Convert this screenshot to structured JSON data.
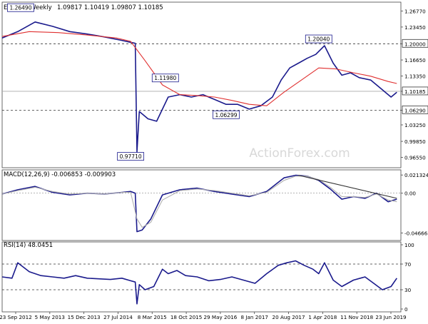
{
  "chart_data": [
    {
      "type": "line",
      "panel": "price",
      "title": "EURCHF Weekly",
      "ohlc_text": "1.09817 1.10419 1.09807 1.10185",
      "ylim": [
        0.95,
        1.28
      ],
      "yticks": [
        "1.26770",
        "1.23450",
        "1.20000",
        "1.16650",
        "1.13350",
        "1.10185",
        "1.06290",
        "1.03250",
        "0.99850",
        "0.96550"
      ],
      "ytick_values": [
        1.2677,
        1.2345,
        1.2,
        1.1665,
        1.1335,
        1.10185,
        1.0629,
        1.0325,
        0.9985,
        0.9655
      ],
      "current_price": 1.10185,
      "hlines": [
        1.2,
        1.10185,
        1.0629
      ],
      "dashed_lines": [
        1.2,
        1.0629
      ],
      "grid": false,
      "series": [
        {
          "name": "",
          "color": "#1a1a8c",
          "x": [
            2012.73,
            2013.0,
            2013.3,
            2013.6,
            2013.9,
            2014.2,
            2014.5,
            2014.8,
            2014.95,
            2015.03,
            2015.06,
            2015.1,
            2015.25,
            2015.4,
            2015.6,
            2015.8,
            2016.0,
            2016.2,
            2016.4,
            2016.6,
            2016.8,
            2017.0,
            2017.2,
            2017.4,
            2017.55,
            2017.7,
            2017.85,
            2018.0,
            2018.15,
            2018.3,
            2018.45,
            2018.6,
            2018.75,
            2018.9,
            2019.1,
            2019.3,
            2019.45,
            2019.55
          ],
          "y": [
            1.212,
            1.225,
            1.245,
            1.236,
            1.225,
            1.22,
            1.214,
            1.207,
            1.203,
            1.201,
            0.977,
            1.06,
            1.045,
            1.04,
            1.09,
            1.095,
            1.09,
            1.095,
            1.085,
            1.075,
            1.075,
            1.065,
            1.072,
            1.09,
            1.125,
            1.15,
            1.16,
            1.17,
            1.178,
            1.196,
            1.16,
            1.135,
            1.14,
            1.13,
            1.125,
            1.105,
            1.09,
            1.1
          ]
        },
        {
          "name": "",
          "color": "#e03030",
          "x": [
            2012.73,
            2013.2,
            2013.7,
            2014.2,
            2014.7,
            2014.95,
            2015.2,
            2015.5,
            2015.8,
            2016.1,
            2016.4,
            2016.7,
            2017.0,
            2017.3,
            2017.6,
            2017.9,
            2018.2,
            2018.5,
            2018.8,
            2019.1,
            2019.4,
            2019.55
          ],
          "y": [
            1.215,
            1.225,
            1.223,
            1.218,
            1.212,
            1.205,
            1.165,
            1.115,
            1.095,
            1.093,
            1.09,
            1.083,
            1.075,
            1.072,
            1.1,
            1.125,
            1.15,
            1.148,
            1.14,
            1.133,
            1.122,
            1.118
          ]
        }
      ],
      "labels": [
        {
          "text": "1.26490",
          "x": 2013.05,
          "y": 1.2649
        },
        {
          "text": "1.20040",
          "x": 2018.2,
          "y": 1.2004
        },
        {
          "text": "1.11980",
          "x": 2015.55,
          "y": 1.1198
        },
        {
          "text": "1.06299",
          "x": 2016.6,
          "y": 1.063
        },
        {
          "text": "0.97710",
          "x": 2014.95,
          "y": 0.9771
        }
      ]
    },
    {
      "type": "line",
      "panel": "macd",
      "title": "MACD(12,26,9) -0.006853 -0.009903",
      "ylim": [
        -0.052,
        0.024
      ],
      "yticks": [
        "0.021324",
        "0.00",
        "-0.046663"
      ],
      "ytick_values": [
        0.021324,
        0.0,
        -0.046663
      ],
      "grid": false,
      "series": [
        {
          "name": "",
          "color": "#1a1a8c",
          "x": [
            2012.73,
            2013.0,
            2013.3,
            2013.6,
            2013.9,
            2014.2,
            2014.5,
            2014.8,
            2014.95,
            2015.03,
            2015.06,
            2015.15,
            2015.3,
            2015.5,
            2015.8,
            2016.1,
            2016.4,
            2016.7,
            2017.0,
            2017.3,
            2017.6,
            2017.8,
            2018.0,
            2018.2,
            2018.4,
            2018.6,
            2018.8,
            2019.0,
            2019.2,
            2019.4,
            2019.55
          ],
          "y": [
            -0.001,
            0.004,
            0.008,
            0.001,
            -0.002,
            0.0,
            -0.001,
            0.001,
            0.002,
            0.0,
            -0.045,
            -0.043,
            -0.03,
            -0.002,
            0.004,
            0.006,
            0.002,
            -0.001,
            -0.004,
            0.002,
            0.018,
            0.021,
            0.02,
            0.015,
            0.005,
            -0.007,
            -0.004,
            -0.006,
            0.0,
            -0.01,
            -0.007
          ]
        },
        {
          "name": "",
          "color": "#b0b0b0",
          "x": [
            2012.73,
            2013.0,
            2013.3,
            2013.6,
            2013.9,
            2014.2,
            2014.5,
            2014.8,
            2014.95,
            2015.06,
            2015.15,
            2015.3,
            2015.5,
            2015.8,
            2016.1,
            2016.4,
            2016.7,
            2017.0,
            2017.3,
            2017.6,
            2017.8,
            2018.0,
            2018.2,
            2018.4,
            2018.6,
            2018.8,
            2019.0,
            2019.2,
            2019.4,
            2019.55
          ],
          "y": [
            -0.001,
            0.003,
            0.007,
            0.002,
            -0.001,
            0.0,
            -0.001,
            0.001,
            0.001,
            -0.03,
            -0.04,
            -0.034,
            -0.008,
            0.003,
            0.005,
            0.003,
            0.0,
            -0.003,
            0.001,
            0.015,
            0.02,
            0.02,
            0.016,
            0.007,
            -0.004,
            -0.004,
            -0.005,
            -0.001,
            -0.008,
            -0.01
          ]
        },
        {
          "name": "",
          "color": "#333333",
          "x": [
            2017.85,
            2019.55
          ],
          "y": [
            0.021,
            -0.006
          ]
        }
      ]
    },
    {
      "type": "line",
      "panel": "rsi",
      "title": "RSI(14) 48.0451",
      "ylim": [
        0,
        100
      ],
      "yticks": [
        "100",
        "70",
        "30",
        "0"
      ],
      "ytick_values": [
        100,
        70,
        30,
        0
      ],
      "dashed_lines": [
        70,
        30
      ],
      "grid": false,
      "series": [
        {
          "name": "",
          "color": "#1a1a8c",
          "x": [
            2012.73,
            2012.9,
            2013.0,
            2013.1,
            2013.2,
            2013.4,
            2013.6,
            2013.8,
            2014.0,
            2014.2,
            2014.4,
            2014.6,
            2014.8,
            2014.95,
            2015.03,
            2015.06,
            2015.1,
            2015.2,
            2015.35,
            2015.5,
            2015.6,
            2015.75,
            2015.9,
            2016.1,
            2016.3,
            2016.5,
            2016.7,
            2016.9,
            2017.1,
            2017.3,
            2017.5,
            2017.65,
            2017.8,
            2017.95,
            2018.1,
            2018.2,
            2018.3,
            2018.45,
            2018.6,
            2018.8,
            2019.0,
            2019.15,
            2019.3,
            2019.45,
            2019.55
          ],
          "y": [
            50,
            48,
            72,
            65,
            58,
            52,
            50,
            48,
            52,
            48,
            47,
            46,
            48,
            44,
            42,
            8,
            38,
            30,
            35,
            62,
            55,
            60,
            52,
            50,
            44,
            46,
            50,
            45,
            40,
            55,
            68,
            72,
            75,
            68,
            62,
            55,
            72,
            45,
            35,
            45,
            50,
            40,
            30,
            35,
            48
          ]
        }
      ]
    }
  ],
  "x_axis_labels": [
    "23 Sep 2012",
    "5 May 2013",
    "15 Dec 2013",
    "27 Jul 2014",
    "8 Mar 2015",
    "18 Oct 2015",
    "29 May 2016",
    "8 Jan 2017",
    "20 Aug 2017",
    "1 Apr 2018",
    "11 Nov 2018",
    "23 Jun 2019"
  ],
  "watermark": "ActionForex.com",
  "colors": {
    "price": "#1a1a8c",
    "ma": "#e03030",
    "signal": "#b0b0b0",
    "trendline": "#333333",
    "label_border": "#1a1a8c"
  }
}
